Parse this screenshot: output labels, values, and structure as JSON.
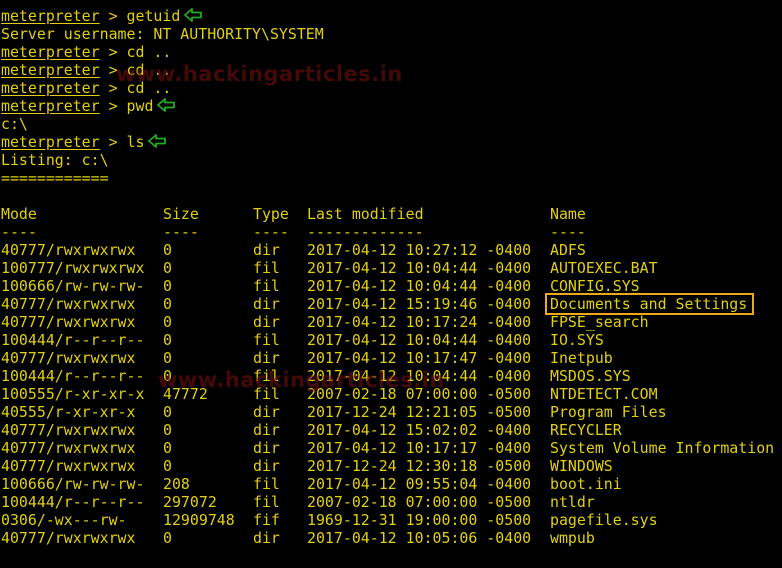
{
  "accent": "#e0d010",
  "arrow_color": "#22aa22",
  "highlight_color": "#f0a818",
  "prompt_name": "meterpreter",
  "prompt_suffix": " > ",
  "commands": [
    {
      "cmd": "getuid",
      "arrow": true
    },
    {
      "output": "Server username: NT AUTHORITY\\SYSTEM"
    },
    {
      "cmd": "cd ..",
      "arrow": false
    },
    {
      "cmd": "cd ..",
      "arrow": false
    },
    {
      "cmd": "cd ..",
      "arrow": false
    },
    {
      "cmd": "pwd",
      "arrow": true
    },
    {
      "output": "c:\\"
    },
    {
      "cmd": "ls",
      "arrow": true
    },
    {
      "output": "Listing: c:\\"
    },
    {
      "output": "============"
    },
    {
      "output": ""
    }
  ],
  "watermark": "www.hackingarticles.in",
  "listing": {
    "headers": {
      "mode": "Mode",
      "size": "Size",
      "type": "Type",
      "date": "Last modified",
      "name": "Name"
    },
    "separators": {
      "mode": "----",
      "size": "----",
      "type": "----",
      "date": "-------------",
      "name": "----"
    },
    "rows": [
      {
        "mode": "40777/rwxrwxrwx",
        "size": "0",
        "type": "dir",
        "date": "2017-04-12 10:27:12 -0400",
        "name": "ADFS"
      },
      {
        "mode": "100777/rwxrwxrwx",
        "size": "0",
        "type": "fil",
        "date": "2017-04-12 10:04:44 -0400",
        "name": "AUTOEXEC.BAT"
      },
      {
        "mode": "100666/rw-rw-rw-",
        "size": "0",
        "type": "fil",
        "date": "2017-04-12 10:04:44 -0400",
        "name": "CONFIG.SYS"
      },
      {
        "mode": "40777/rwxrwxrwx",
        "size": "0",
        "type": "dir",
        "date": "2017-04-12 15:19:46 -0400",
        "name": "Documents and Settings",
        "highlighted": true
      },
      {
        "mode": "40777/rwxrwxrwx",
        "size": "0",
        "type": "dir",
        "date": "2017-04-12 10:17:24 -0400",
        "name": "FPSE_search"
      },
      {
        "mode": "100444/r--r--r--",
        "size": "0",
        "type": "fil",
        "date": "2017-04-12 10:04:44 -0400",
        "name": "IO.SYS"
      },
      {
        "mode": "40777/rwxrwxrwx",
        "size": "0",
        "type": "dir",
        "date": "2017-04-12 10:17:47 -0400",
        "name": "Inetpub"
      },
      {
        "mode": "100444/r--r--r--",
        "size": "0",
        "type": "fil",
        "date": "2017-04-12 10:04:44 -0400",
        "name": "MSDOS.SYS"
      },
      {
        "mode": "100555/r-xr-xr-x",
        "size": "47772",
        "type": "fil",
        "date": "2007-02-18 07:00:00 -0500",
        "name": "NTDETECT.COM"
      },
      {
        "mode": "40555/r-xr-xr-x",
        "size": "0",
        "type": "dir",
        "date": "2017-12-24 12:21:05 -0500",
        "name": "Program Files"
      },
      {
        "mode": "40777/rwxrwxrwx",
        "size": "0",
        "type": "dir",
        "date": "2017-04-12 15:02:02 -0400",
        "name": "RECYCLER"
      },
      {
        "mode": "40777/rwxrwxrwx",
        "size": "0",
        "type": "dir",
        "date": "2017-04-12 10:17:17 -0400",
        "name": "System Volume Information"
      },
      {
        "mode": "40777/rwxrwxrwx",
        "size": "0",
        "type": "dir",
        "date": "2017-12-24 12:30:18 -0500",
        "name": "WINDOWS"
      },
      {
        "mode": "100666/rw-rw-rw-",
        "size": "208",
        "type": "fil",
        "date": "2017-04-12 09:55:04 -0400",
        "name": "boot.ini"
      },
      {
        "mode": "100444/r--r--r--",
        "size": "297072",
        "type": "fil",
        "date": "2007-02-18 07:00:00 -0500",
        "name": "ntldr"
      },
      {
        "mode": "0306/-wx---rw-",
        "size": "12909748",
        "type": "fif",
        "date": "1969-12-31 19:00:00 -0500",
        "name": "pagefile.sys"
      },
      {
        "mode": "40777/rwxrwxrwx",
        "size": "0",
        "type": "dir",
        "date": "2017-04-12 10:05:06 -0400",
        "name": "wmpub"
      }
    ]
  }
}
